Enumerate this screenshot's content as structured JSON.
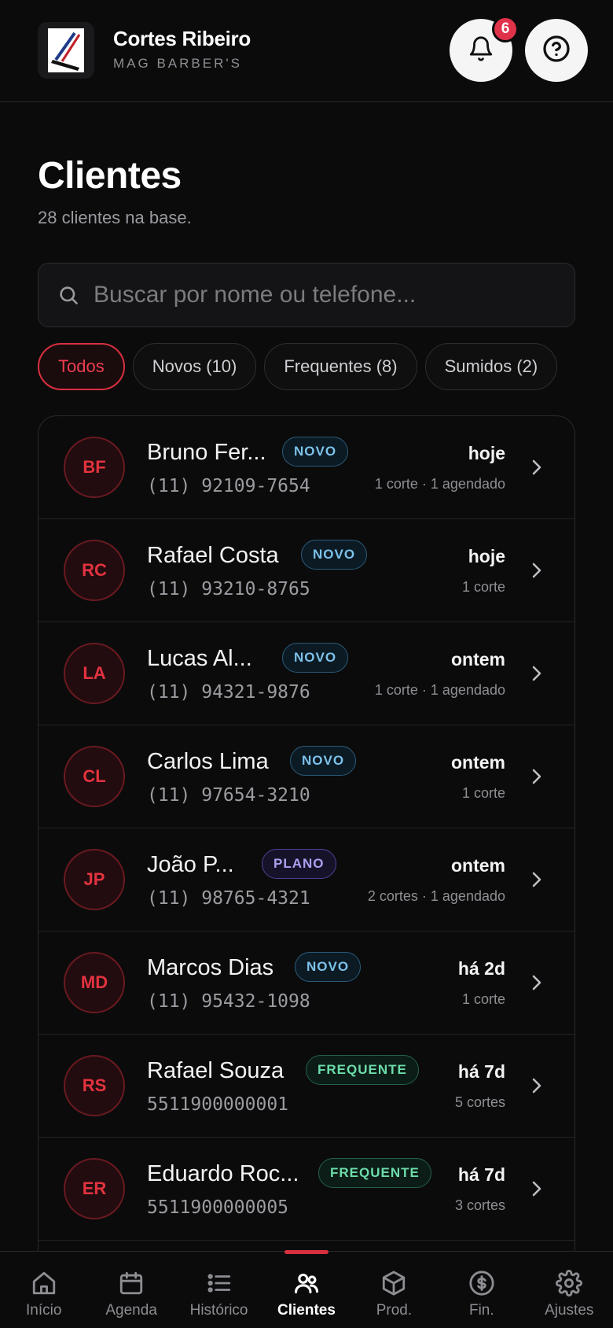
{
  "header": {
    "brand_name": "Cortes Ribeiro",
    "brand_subtitle": "MAG BARBER'S",
    "notification_count": "6"
  },
  "page": {
    "title": "Clientes",
    "subtitle": "28 clientes na base."
  },
  "search": {
    "placeholder": "Buscar por nome ou telefone..."
  },
  "filters": [
    {
      "label": "Todos",
      "active": true
    },
    {
      "label": "Novos (10)",
      "active": false
    },
    {
      "label": "Frequentes (8)",
      "active": false
    },
    {
      "label": "Sumidos (2)",
      "active": false
    }
  ],
  "clients": [
    {
      "initials": "BF",
      "name": "Bruno Fer...",
      "phone": "(11) 92109-7654",
      "tag": "NOVO",
      "tag_type": "novo",
      "when": "hoje",
      "meta": "1 corte · 1 agendado"
    },
    {
      "initials": "RC",
      "name": "Rafael Costa",
      "phone": "(11) 93210-8765",
      "tag": "NOVO",
      "tag_type": "novo",
      "when": "hoje",
      "meta": "1 corte"
    },
    {
      "initials": "LA",
      "name": "Lucas Al...",
      "phone": "(11) 94321-9876",
      "tag": "NOVO",
      "tag_type": "novo",
      "when": "ontem",
      "meta": "1 corte · 1 agendado"
    },
    {
      "initials": "CL",
      "name": "Carlos Lima",
      "phone": "(11) 97654-3210",
      "tag": "NOVO",
      "tag_type": "novo",
      "when": "ontem",
      "meta": "1 corte"
    },
    {
      "initials": "JP",
      "name": "João P...",
      "phone": "(11) 98765-4321",
      "tag": "PLANO",
      "tag_type": "plano",
      "when": "ontem",
      "meta": "2 cortes · 1 agendado"
    },
    {
      "initials": "MD",
      "name": "Marcos Dias",
      "phone": "(11) 95432-1098",
      "tag": "NOVO",
      "tag_type": "novo",
      "when": "há 2d",
      "meta": "1 corte"
    },
    {
      "initials": "RS",
      "name": "Rafael Souza",
      "phone": "5511900000001",
      "tag": "FREQUENTE",
      "tag_type": "frequente",
      "when": "há 7d",
      "meta": "5 cortes"
    },
    {
      "initials": "ER",
      "name": "Eduardo Roc...",
      "phone": "5511900000005",
      "tag": "FREQUENTE",
      "tag_type": "frequente",
      "when": "há 7d",
      "meta": "3 cortes"
    }
  ],
  "nav": [
    {
      "label": "Início",
      "icon": "home-icon",
      "active": false
    },
    {
      "label": "Agenda",
      "icon": "calendar-icon",
      "active": false
    },
    {
      "label": "Histórico",
      "icon": "list-icon",
      "active": false
    },
    {
      "label": "Clientes",
      "icon": "users-icon",
      "active": true
    },
    {
      "label": "Prod.",
      "icon": "box-icon",
      "active": false
    },
    {
      "label": "Fin.",
      "icon": "dollar-circle-icon",
      "active": false
    },
    {
      "label": "Ajustes",
      "icon": "gear-icon",
      "active": false
    }
  ],
  "colors": {
    "accent": "#d8303f",
    "background": "#0b0b0c",
    "tag_novo": "#7cc2ea",
    "tag_plano": "#aba1f0",
    "tag_frequente": "#6ddcaa"
  }
}
